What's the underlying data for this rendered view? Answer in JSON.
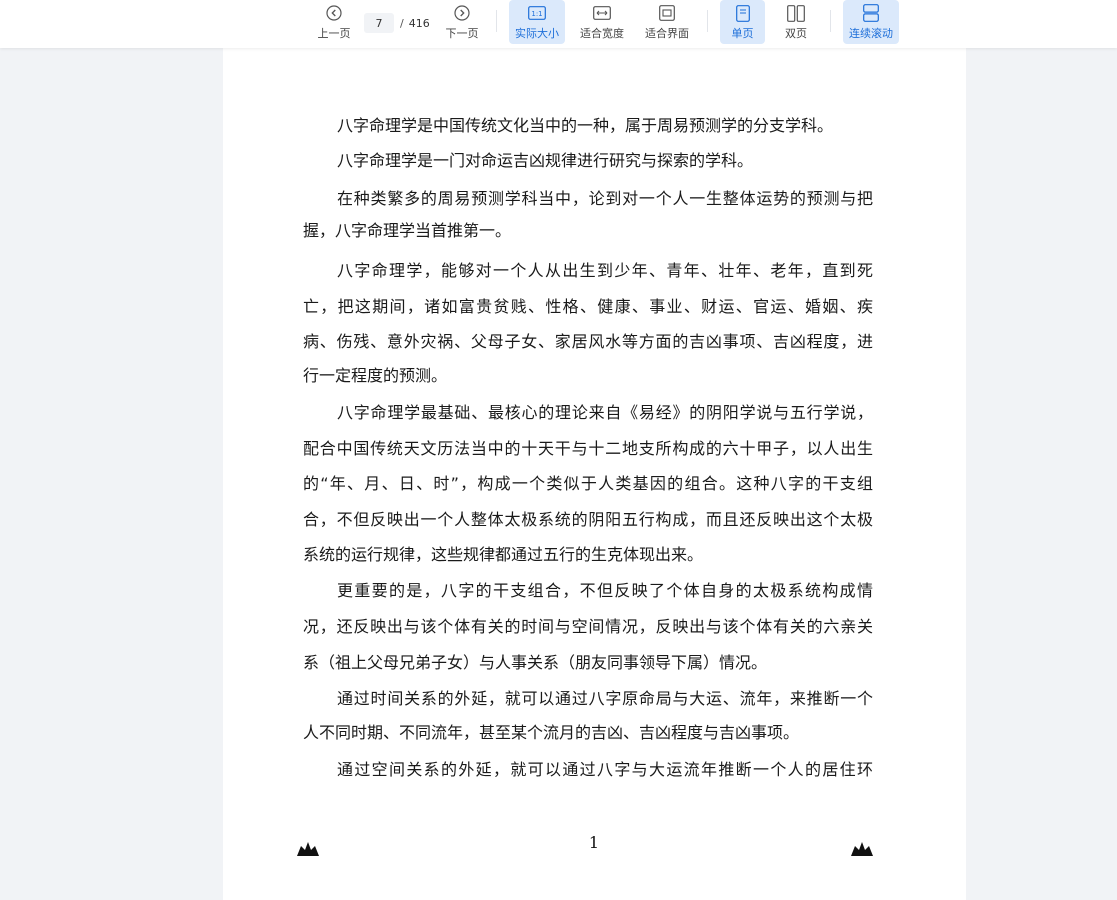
{
  "toolbar": {
    "prev_label": "上一页",
    "next_label": "下一页",
    "current_page": "7",
    "page_separator": "/",
    "total_pages": "416",
    "actual_size_label": "实际大小",
    "fit_width_label": "适合宽度",
    "fit_page_label": "适合界面",
    "single_page_label": "单页",
    "double_page_label": "双页",
    "continuous_label": "连续滚动",
    "actual_size_icon_text": "1:1",
    "active_zoom": "实际大小",
    "active_layout": "单页",
    "active_scroll": "连续滚动",
    "accent_color": "#1e6fd9",
    "active_bg": "#dbe9fb"
  },
  "document": {
    "lines": [
      "八字命理学是中国传统文化当中的一种，属于周易预测学的分支学科。",
      "八字命理学是一门对命运吉凶规律进行研究与探索的学科。",
      "在种类繁多的周易预测学科当中，论到对一个人一生整体运势的预测与把",
      "握，八字命理学当首推第一。",
      "八字命理学，能够对一个人从出生到少年、青年、壮年、老年，直到死",
      "亡，把这期间，诸如富贵贫贱、性格、健康、事业、财运、官运、婚姻、疾",
      "病、伤残、意外灾祸、父母子女、家居风水等方面的吉凶事项、吉凶程度，进",
      "行一定程度的预测。",
      "八字命理学最基础、最核心的理论来自《易经》的阴阳学说与五行学说，",
      "配合中国传统天文历法当中的十天干与十二地支所构成的六十甲子，以人出生",
      "的“年、月、日、时”，构成一个类似于人类基因的组合。这种八字的干支组",
      "合，不但反映出一个人整体太极系统的阴阳五行构成，而且还反映出这个太极",
      "系统的运行规律，这些规律都通过五行的生克体现出来。",
      "更重要的是，八字的干支组合，不但反映了个体自身的太极系统构成情",
      "况，还反映出与该个体有关的时间与空间情况，反映出与该个体有关的六亲关",
      "系（祖上父母兄弟子女）与人事关系（朋友同事领导下属）情况。",
      "通过时间关系的外延，就可以通过八字原命局与大运、流年，来推断一个",
      "人不同时期、不同流年，甚至某个流月的吉凶、吉凶程度与吉凶事项。",
      "通过空间关系的外延，就可以通过八字与大运流年推断一个人的居住环"
    ],
    "page_number": "1"
  }
}
